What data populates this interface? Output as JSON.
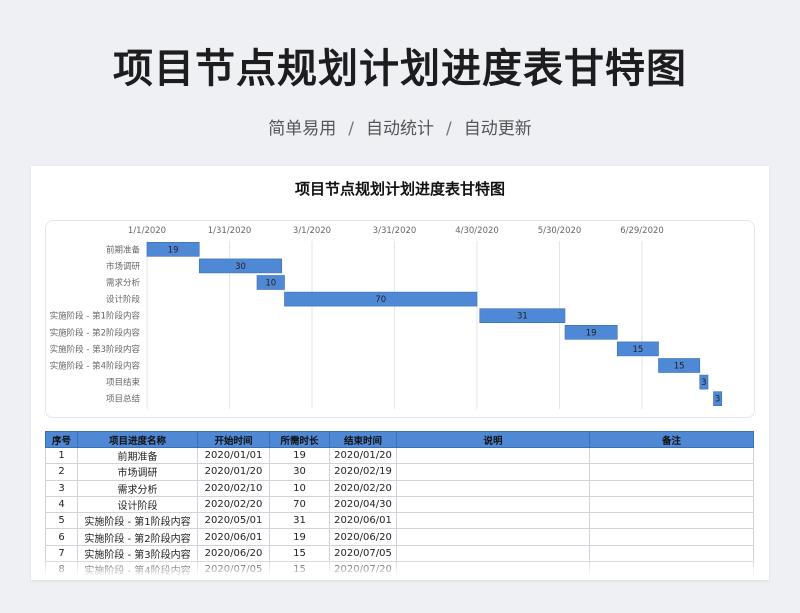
{
  "header": {
    "title": "项目节点规划计划进度表甘特图",
    "subtitle_items": [
      "简单易用",
      "自动统计",
      "自动更新"
    ],
    "subtitle_separator": "/"
  },
  "chart_data": {
    "type": "bar",
    "orientation": "horizontal-gantt",
    "title": "项目节点规划计划进度表甘特图",
    "x_axis": {
      "type": "date",
      "position": "top",
      "range": [
        "2020-01-01",
        "2020-07-31"
      ],
      "tick_labels": [
        "1/1/2020",
        "1/31/2020",
        "3/1/2020",
        "3/31/2020",
        "4/30/2020",
        "5/30/2020",
        "6/29/2020"
      ],
      "tick_values": [
        "2020-01-01",
        "2020-01-31",
        "2020-03-01",
        "2020-03-31",
        "2020-04-30",
        "2020-05-30",
        "2020-06-29"
      ]
    },
    "grid": true,
    "bar_color": "#4f88d4",
    "tasks": [
      {
        "name": "前期准备",
        "start": "2020-01-01",
        "duration": 19
      },
      {
        "name": "市场调研",
        "start": "2020-01-20",
        "duration": 30
      },
      {
        "name": "需求分析",
        "start": "2020-02-10",
        "duration": 10
      },
      {
        "name": "设计阶段",
        "start": "2020-02-20",
        "duration": 70
      },
      {
        "name": "实施阶段 - 第1阶段内容",
        "start": "2020-05-01",
        "duration": 31
      },
      {
        "name": "实施阶段 - 第2阶段内容",
        "start": "2020-06-01",
        "duration": 19
      },
      {
        "name": "实施阶段 - 第3阶段内容",
        "start": "2020-06-20",
        "duration": 15
      },
      {
        "name": "实施阶段 - 第4阶段内容",
        "start": "2020-07-05",
        "duration": 15
      },
      {
        "name": "项目结束",
        "start": "2020-07-20",
        "duration": 3
      },
      {
        "name": "项目总结",
        "start": "2020-07-25",
        "duration": 3
      }
    ]
  },
  "table": {
    "columns": [
      "序号",
      "项目进度名称",
      "开始时间",
      "所需时长",
      "结束时间",
      "说明",
      "备注"
    ],
    "rows": [
      [
        "1",
        "前期准备",
        "2020/01/01",
        "19",
        "2020/01/20",
        "",
        ""
      ],
      [
        "2",
        "市场调研",
        "2020/01/20",
        "30",
        "2020/02/19",
        "",
        ""
      ],
      [
        "3",
        "需求分析",
        "2020/02/10",
        "10",
        "2020/02/20",
        "",
        ""
      ],
      [
        "4",
        "设计阶段",
        "2020/02/20",
        "70",
        "2020/04/30",
        "",
        ""
      ],
      [
        "5",
        "实施阶段 - 第1阶段内容",
        "2020/05/01",
        "31",
        "2020/06/01",
        "",
        ""
      ],
      [
        "6",
        "实施阶段 - 第2阶段内容",
        "2020/06/01",
        "19",
        "2020/06/20",
        "",
        ""
      ],
      [
        "7",
        "实施阶段 - 第3阶段内容",
        "2020/06/20",
        "15",
        "2020/07/05",
        "",
        ""
      ],
      [
        "8",
        "实施阶段 - 第4阶段内容",
        "2020/07/05",
        "15",
        "2020/07/20",
        "",
        ""
      ]
    ]
  }
}
